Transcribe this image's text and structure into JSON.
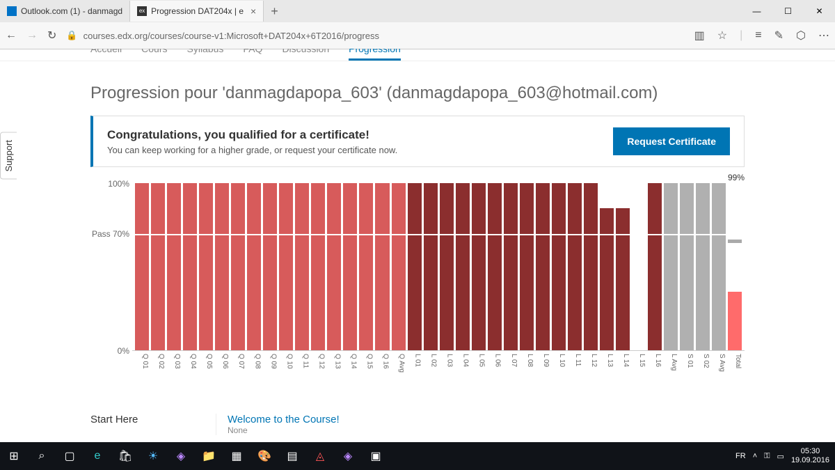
{
  "browser": {
    "tabs": [
      {
        "label": "Outlook.com (1) - danmagd"
      },
      {
        "label": "Progression DAT204x | e"
      }
    ],
    "url": "courses.edx.org/courses/course-v1:Microsoft+DAT204x+6T2016/progress"
  },
  "nav": {
    "items": [
      "Accueil",
      "Cours",
      "Syllabus",
      "FAQ",
      "Discussion",
      "Progression"
    ],
    "active": "Progression"
  },
  "page_title": "Progression pour 'danmagdapopa_603' (danmagdapopa_603@hotmail.com)",
  "cert": {
    "title": "Congratulations, you qualified for a certificate!",
    "subtitle": "You can keep working for a higher grade, or request your certificate now.",
    "button": "Request Certificate"
  },
  "support_label": "Support",
  "chart_data": {
    "type": "bar",
    "ylabels": [
      {
        "text": "100%",
        "value": 100
      },
      {
        "text": "Pass 70%",
        "value": 70
      },
      {
        "text": "0%",
        "value": 0
      }
    ],
    "pass_line": 70,
    "total_label": "99%",
    "series": [
      {
        "label": "Q 01",
        "value": 100,
        "color": "#d75b5b"
      },
      {
        "label": "Q 02",
        "value": 100,
        "color": "#d75b5b"
      },
      {
        "label": "Q 03",
        "value": 100,
        "color": "#d75b5b"
      },
      {
        "label": "Q 04",
        "value": 100,
        "color": "#d75b5b"
      },
      {
        "label": "Q 05",
        "value": 100,
        "color": "#d75b5b"
      },
      {
        "label": "Q 06",
        "value": 100,
        "color": "#d75b5b"
      },
      {
        "label": "Q 07",
        "value": 100,
        "color": "#d75b5b"
      },
      {
        "label": "Q 08",
        "value": 100,
        "color": "#d75b5b"
      },
      {
        "label": "Q 09",
        "value": 100,
        "color": "#d75b5b"
      },
      {
        "label": "Q 10",
        "value": 100,
        "color": "#d75b5b"
      },
      {
        "label": "Q 11",
        "value": 100,
        "color": "#d75b5b"
      },
      {
        "label": "Q 12",
        "value": 100,
        "color": "#d75b5b"
      },
      {
        "label": "Q 13",
        "value": 100,
        "color": "#d75b5b"
      },
      {
        "label": "Q 14",
        "value": 100,
        "color": "#d75b5b"
      },
      {
        "label": "Q 15",
        "value": 100,
        "color": "#d75b5b"
      },
      {
        "label": "Q 16",
        "value": 100,
        "color": "#d75b5b"
      },
      {
        "label": "Q Avg",
        "value": 100,
        "color": "#d75b5b"
      },
      {
        "label": "L 01",
        "value": 100,
        "color": "#8b2e2e"
      },
      {
        "label": "L 02",
        "value": 100,
        "color": "#8b2e2e"
      },
      {
        "label": "L 03",
        "value": 100,
        "color": "#8b2e2e"
      },
      {
        "label": "L 04",
        "value": 100,
        "color": "#8b2e2e"
      },
      {
        "label": "L 05",
        "value": 100,
        "color": "#8b2e2e"
      },
      {
        "label": "L 06",
        "value": 100,
        "color": "#8b2e2e"
      },
      {
        "label": "L 07",
        "value": 100,
        "color": "#8b2e2e"
      },
      {
        "label": "L 08",
        "value": 100,
        "color": "#8b2e2e"
      },
      {
        "label": "L 09",
        "value": 100,
        "color": "#8b2e2e"
      },
      {
        "label": "L 10",
        "value": 100,
        "color": "#8b2e2e"
      },
      {
        "label": "L 11",
        "value": 100,
        "color": "#8b2e2e"
      },
      {
        "label": "L 12",
        "value": 100,
        "color": "#8b2e2e"
      },
      {
        "label": "L 13",
        "value": 85,
        "color": "#8b2e2e"
      },
      {
        "label": "L 14",
        "value": 85,
        "color": "#8b2e2e"
      },
      {
        "label": "L 15",
        "value": 0,
        "color": "#8b2e2e"
      },
      {
        "label": "L 16",
        "value": 100,
        "color": "#8b2e2e"
      },
      {
        "label": "L Avg",
        "value": 100,
        "color": "#b0b0b0"
      },
      {
        "label": "S 01",
        "value": 100,
        "color": "#b0b0b0"
      },
      {
        "label": "S 02",
        "value": 100,
        "color": "#b0b0b0"
      },
      {
        "label": "S Avg",
        "value": 100,
        "color": "#b0b0b0"
      },
      {
        "label": "Total",
        "value": 35,
        "color": "#ff6b6b",
        "cap": 99
      }
    ]
  },
  "bottom": {
    "start": "Start Here",
    "welcome_title": "Welcome to the Course!",
    "welcome_sub": "None"
  },
  "taskbar": {
    "lang": "FR",
    "time": "05:30",
    "date": "19.09.2016"
  }
}
